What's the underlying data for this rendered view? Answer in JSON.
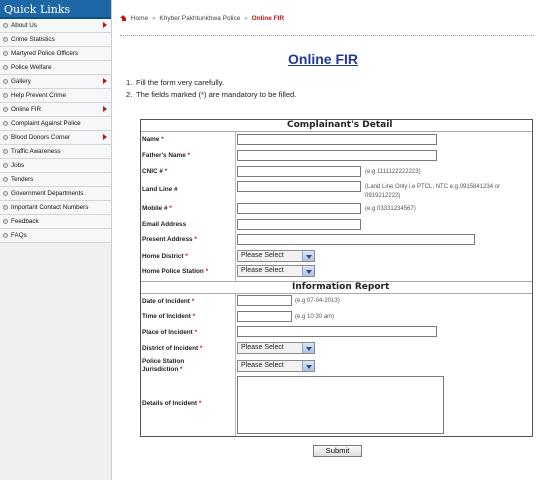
{
  "sidebar": {
    "title": "Quick Links",
    "items": [
      {
        "label": "About Us",
        "arrow": true
      },
      {
        "label": "Crime Statistics",
        "arrow": false
      },
      {
        "label": "Martyred Police Officers",
        "arrow": false
      },
      {
        "label": "Police Welfare",
        "arrow": false
      },
      {
        "label": "Gallery",
        "arrow": true
      },
      {
        "label": "Help Prevent Crime",
        "arrow": false
      },
      {
        "label": "Online FIR",
        "arrow": true
      },
      {
        "label": "Complaint Against Police",
        "arrow": false
      },
      {
        "label": "Blood Donors Corner",
        "arrow": true
      },
      {
        "label": "Traffic Awareness",
        "arrow": false
      },
      {
        "label": "Jobs",
        "arrow": false
      },
      {
        "label": "Tenders",
        "arrow": false
      },
      {
        "label": "Government Departments",
        "arrow": false
      },
      {
        "label": "Important Contact Numbers",
        "arrow": false
      },
      {
        "label": "Feedback",
        "arrow": false
      },
      {
        "label": "FAQs",
        "arrow": false
      }
    ]
  },
  "breadcrumb": {
    "home": "Home",
    "separator": "»",
    "section": "Khyber Pakhtunkhwa Police",
    "current": "Online FIR"
  },
  "page": {
    "title": "Online FIR",
    "instructions": [
      {
        "num": "1.",
        "text": "Fill the form very carefully."
      },
      {
        "num": "2.",
        "text": "The fields marked (*) are mandatory to be filled."
      }
    ]
  },
  "form": {
    "complainant_section_title": "Complainant's Detail",
    "report_section_title": "Information Report",
    "fields": {
      "name": {
        "label": "Name",
        "required": "*",
        "value": ""
      },
      "father_name": {
        "label": "Father's Name",
        "required": "*",
        "value": ""
      },
      "cnic": {
        "label": "CNIC #",
        "required": "*",
        "value": "",
        "hint": "(e.g 1111122222223)"
      },
      "landline": {
        "label": "Land Line #",
        "required": "",
        "value": "",
        "hint": "(Land Line Only i.e PTCL, NTC e.g 0915841234 or 0919212222)"
      },
      "mobile": {
        "label": "Mobile #",
        "required": "*",
        "value": "",
        "hint": "(e.g 03331234567)"
      },
      "email": {
        "label": "Email Address",
        "required": "",
        "value": ""
      },
      "present_address": {
        "label": "Present Address",
        "required": "*",
        "value": ""
      },
      "home_district": {
        "label": "Home District",
        "required": "*",
        "selected": "Please Select"
      },
      "home_police_station": {
        "label": "Home Police Station",
        "required": "*",
        "selected": "Please Select"
      },
      "date_of_incident": {
        "label": "Date of Incident",
        "required": "*",
        "value": "",
        "hint": "(e.g 07-04-2013)"
      },
      "time_of_incident": {
        "label": "Time of Incident",
        "required": "*",
        "value": "",
        "hint": "(e.g 10:30 am)"
      },
      "place_of_incident": {
        "label": "Place of Incident",
        "required": "*",
        "value": ""
      },
      "district_of_incident": {
        "label": "District of Incident",
        "required": "*",
        "selected": "Please Select"
      },
      "police_station_jurisdiction": {
        "label_line1": "Police Station",
        "label_line2": "Jurisdiction",
        "required": "*",
        "selected": "Please Select"
      },
      "details_of_incident": {
        "label": "Details of Incident",
        "required": "*",
        "value": ""
      }
    },
    "submit_label": "Submit"
  },
  "icons": {
    "bullet": "circle-bullet-icon",
    "arrow": "red-arrow-right-icon",
    "home": "home-icon",
    "dropdown": "chevron-down-icon"
  },
  "colors": {
    "header_blue": "#1d67a6",
    "title_blue": "#1f3a93",
    "accent_red": "#c0161a"
  }
}
